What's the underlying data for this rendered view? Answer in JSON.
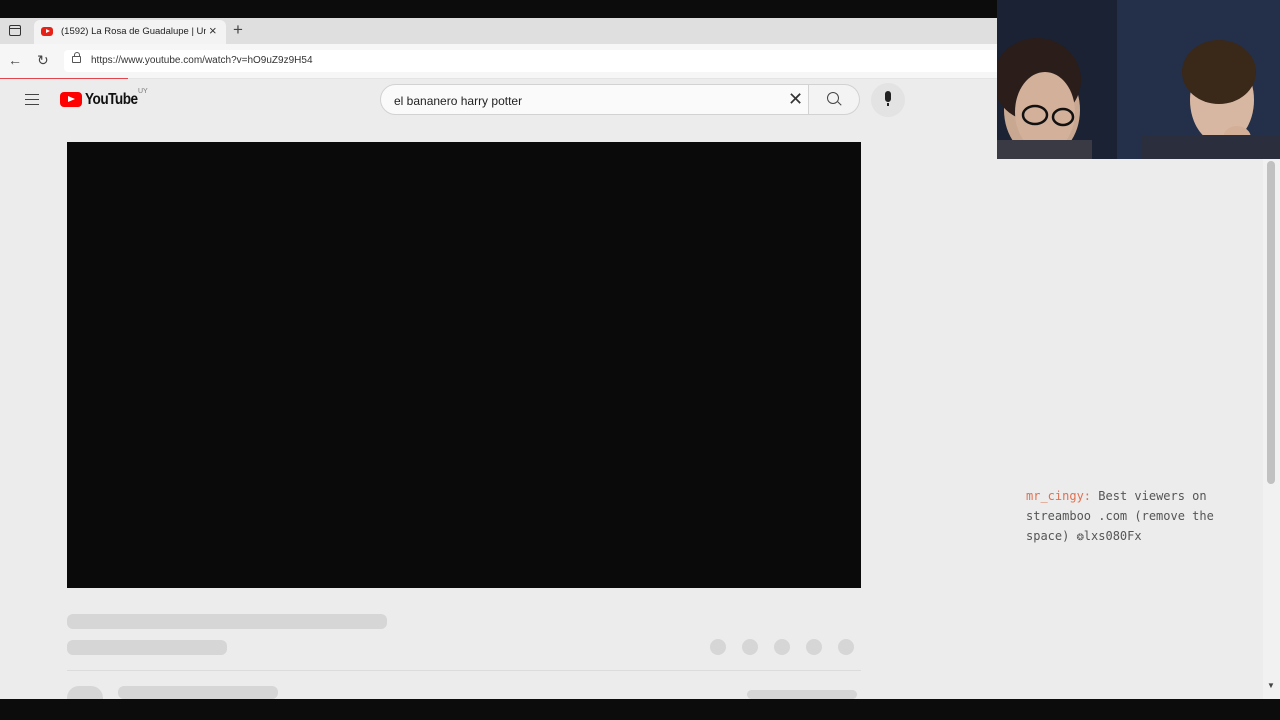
{
  "browser": {
    "tab": {
      "title": "(1592) La Rosa de Guadalupe | Un",
      "close": "×"
    },
    "new_tab": "+",
    "url": "https://www.youtube.com/watch?v=hO9uZ9z9H54"
  },
  "youtube": {
    "wordmark": "YouTube",
    "country": "UY",
    "search": {
      "query": "el bananero harry potter",
      "clear": "✕"
    }
  },
  "chat": {
    "username": "mr_cingy:",
    "message": "Best viewers on streamboo .com (remove the space) ❂lxs080Fx"
  },
  "colors": {
    "accent": "#ff0000",
    "chat_user": "#e07050"
  }
}
